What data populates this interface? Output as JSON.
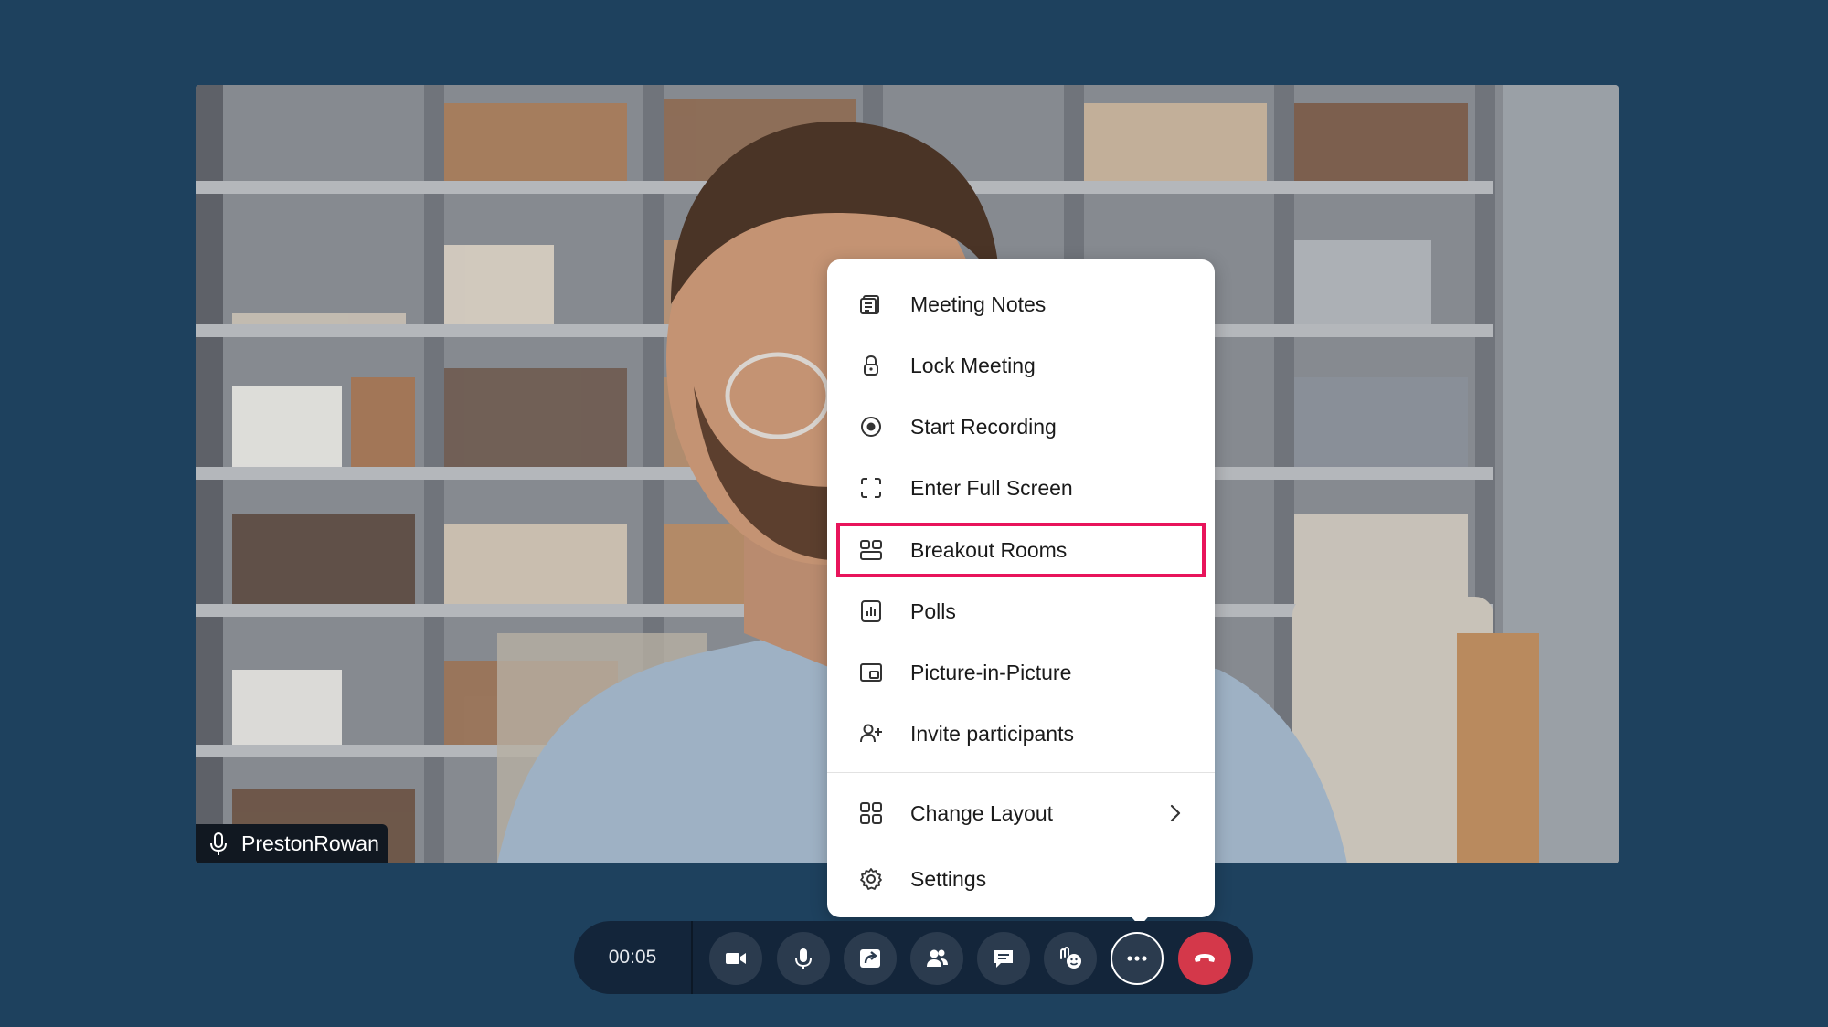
{
  "participant": {
    "name": "PrestonRowan"
  },
  "menu": {
    "items": [
      {
        "label": "Meeting Notes",
        "icon": "notes-icon"
      },
      {
        "label": "Lock Meeting",
        "icon": "lock-icon"
      },
      {
        "label": "Start Recording",
        "icon": "record-icon"
      },
      {
        "label": "Enter Full Screen",
        "icon": "fullscreen-icon"
      },
      {
        "label": "Breakout Rooms",
        "icon": "breakout-rooms-icon",
        "highlighted": true
      },
      {
        "label": "Polls",
        "icon": "polls-icon"
      },
      {
        "label": "Picture-in-Picture",
        "icon": "picture-in-picture-icon"
      },
      {
        "label": "Invite participants",
        "icon": "invite-participant-icon"
      },
      {
        "label": "Change Layout",
        "icon": "grid-layout-icon",
        "has_submenu": true
      },
      {
        "label": "Settings",
        "icon": "gear-icon"
      }
    ]
  },
  "toolbar": {
    "timer": "00:05",
    "buttons": [
      {
        "name": "camera",
        "icon": "video-camera-icon"
      },
      {
        "name": "microphone",
        "icon": "microphone-icon"
      },
      {
        "name": "share-screen",
        "icon": "share-screen-icon"
      },
      {
        "name": "participants",
        "icon": "participants-icon"
      },
      {
        "name": "chat",
        "icon": "chat-icon"
      },
      {
        "name": "reactions",
        "icon": "raise-hand-reaction-icon"
      },
      {
        "name": "more-options",
        "icon": "more-dots-icon",
        "active": true
      },
      {
        "name": "end-call",
        "icon": "hang-up-icon"
      }
    ]
  },
  "colors": {
    "page_background": "#1e415e",
    "toolbar_background": "#13253a",
    "toolbar_button": "#2b3b4e",
    "end_call": "#d4384a",
    "highlight_border": "#e8145b",
    "menu_background": "#ffffff"
  }
}
